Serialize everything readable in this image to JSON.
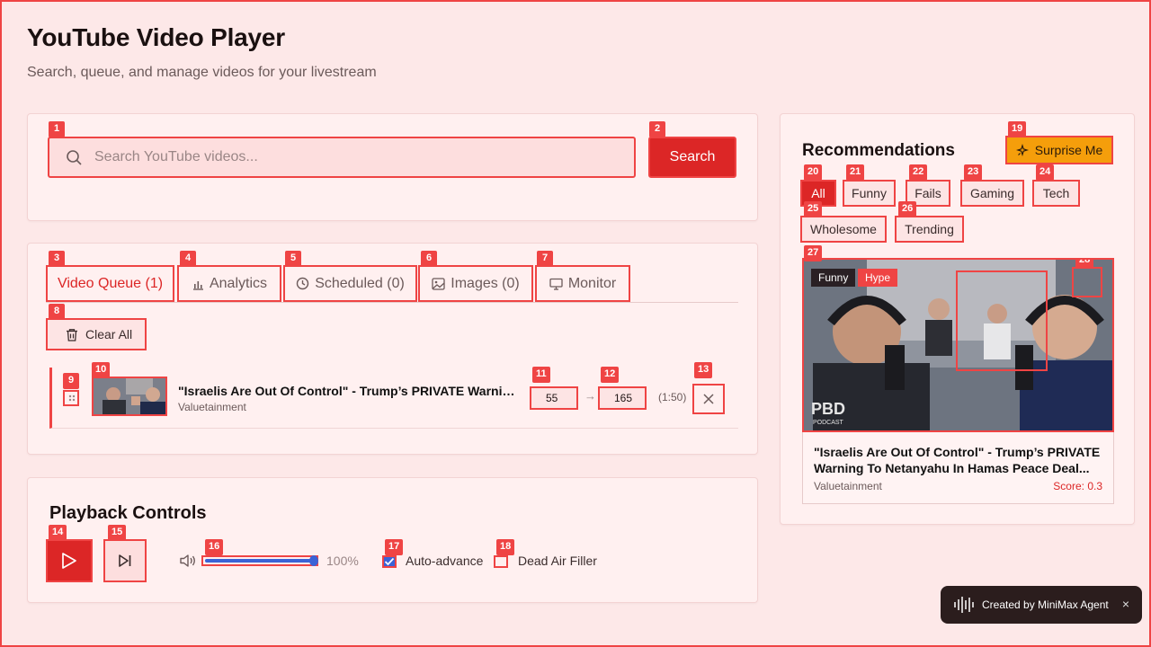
{
  "header": {
    "title": "YouTube Video Player",
    "subtitle": "Search, queue, and manage videos for your livestream"
  },
  "search": {
    "placeholder": "Search YouTube videos...",
    "button_label": "Search"
  },
  "tabs": [
    {
      "label": "Video Queue (1)",
      "icon": "none",
      "active": true
    },
    {
      "label": "Analytics",
      "icon": "bar-chart-icon"
    },
    {
      "label": "Scheduled (0)",
      "icon": "clock-icon"
    },
    {
      "label": "Images (0)",
      "icon": "image-icon"
    },
    {
      "label": "Monitor",
      "icon": "monitor-icon"
    }
  ],
  "queue": {
    "clear_label": "Clear All",
    "items": [
      {
        "title": "\"Israelis Are Out Of Control\" - Trump’s PRIVATE Warning To Netanyahu In Hamas Peace Deal",
        "channel": "Valuetainment",
        "start": "55",
        "end": "165",
        "duration": "(1:50)"
      }
    ]
  },
  "playback": {
    "title": "Playback Controls",
    "volume_percent": 100,
    "volume_label": "100%",
    "auto_advance_label": "Auto-advance",
    "auto_advance_checked": true,
    "dead_air_label": "Dead Air Filler",
    "dead_air_checked": false
  },
  "recommendations": {
    "title": "Recommendations",
    "surprise_label": "Surprise Me",
    "filters": [
      "All",
      "Funny",
      "Fails",
      "Gaming",
      "Tech",
      "Wholesome",
      "Trending"
    ],
    "active_filter": "All",
    "card": {
      "tags": [
        "Funny",
        "Hype"
      ],
      "title": "\"Israelis Are Out Of Control\" - Trump’s PRIVATE Warning To Netanyahu In Hamas Peace Deal...",
      "channel": "Valuetainment",
      "score": "Score: 0.3",
      "thumb_text": "PBD",
      "thumb_subtext": "PODCAST"
    }
  },
  "toast": {
    "label": "Created by MiniMax Agent",
    "close": "×"
  },
  "markers": [
    "1",
    "2",
    "3",
    "4",
    "5",
    "6",
    "7",
    "8",
    "9",
    "10",
    "11",
    "12",
    "13",
    "14",
    "15",
    "16",
    "17",
    "18",
    "19",
    "20",
    "21",
    "22",
    "23",
    "24",
    "25",
    "26",
    "27",
    "28"
  ],
  "colors": {
    "accent": "#dc2626",
    "highlight": "#ef4444",
    "background": "#fde8e8",
    "surprise": "#f59e0b",
    "slider": "#3b63d6"
  }
}
